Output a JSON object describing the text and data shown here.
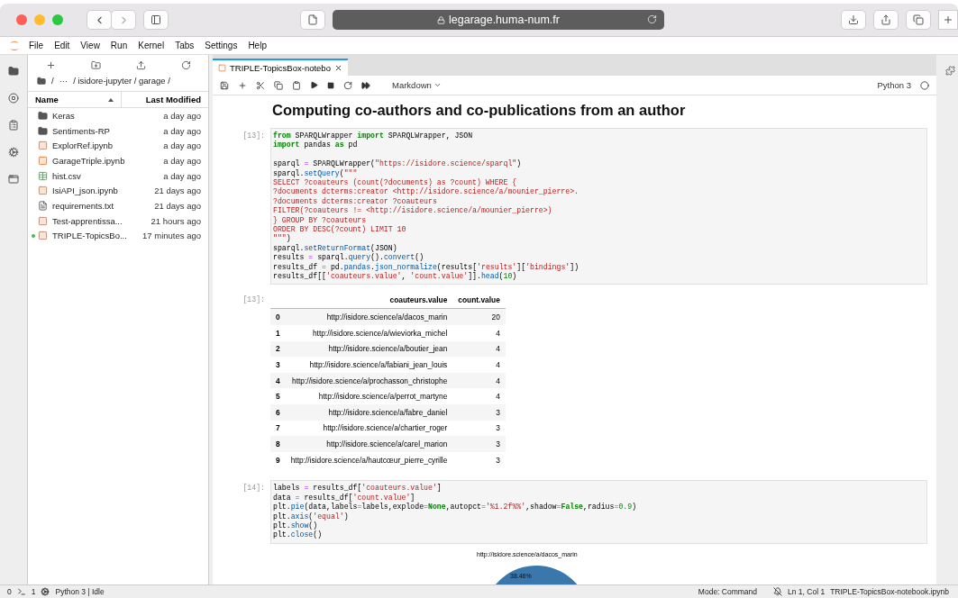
{
  "browser": {
    "url": "legarage.huma-num.fr"
  },
  "menu": [
    "File",
    "Edit",
    "View",
    "Run",
    "Kernel",
    "Tabs",
    "Settings",
    "Help"
  ],
  "file_browser": {
    "breadcrumb": [
      "/",
      "···",
      "/ isidore-jupyter / garage /"
    ],
    "columns": [
      {
        "label": "Name",
        "sorted": true
      },
      {
        "label": "Last Modified",
        "sorted": false
      }
    ],
    "files": [
      {
        "name": "Keras",
        "kind": "folder",
        "modified": "a day ago",
        "running": false
      },
      {
        "name": "Sentiments-RP",
        "kind": "folder",
        "modified": "a day ago",
        "running": false
      },
      {
        "name": "ExplorRef.ipynb",
        "kind": "notebook",
        "modified": "a day ago",
        "running": false
      },
      {
        "name": "GarageTriple.ipynb",
        "kind": "notebook",
        "modified": "a day ago",
        "running": false
      },
      {
        "name": "hist.csv",
        "kind": "csv",
        "modified": "a day ago",
        "running": false
      },
      {
        "name": "IsiAPI_json.ipynb",
        "kind": "notebook",
        "modified": "21 days ago",
        "running": false
      },
      {
        "name": "requirements.txt",
        "kind": "text",
        "modified": "21 days ago",
        "running": false
      },
      {
        "name": "Test-apprentissa...",
        "kind": "notebook",
        "modified": "21 hours ago",
        "running": false
      },
      {
        "name": "TRIPLE-TopicsBo...",
        "kind": "notebook",
        "modified": "17 minutes ago",
        "running": true
      }
    ]
  },
  "notebook": {
    "tab": {
      "title": "TRIPLE-TopicsBox-notebo",
      "selected": true
    },
    "cell_type": "Markdown",
    "kernel": "Python 3",
    "heading": "Computing co-authors and co-publications from an author",
    "cells": [
      {
        "prompt": "[13]:",
        "blocks": [
          [
            [
              {
                "kind": "keyword",
                "text": "from"
              },
              {
                "kind": "plain",
                "text": " SPARQLWrapper "
              },
              {
                "kind": "keyword",
                "text": "import"
              },
              {
                "kind": "plain",
                "text": " SPARQLWrapper, JSON"
              }
            ],
            [
              {
                "kind": "keyword",
                "text": "import"
              },
              {
                "kind": "plain",
                "text": " pandas "
              },
              {
                "kind": "keyword",
                "text": "as"
              },
              {
                "kind": "plain",
                "text": " pd"
              }
            ]
          ],
          [
            [
              {
                "kind": "plain",
                "text": "sparql "
              },
              {
                "kind": "operator",
                "text": "="
              },
              {
                "kind": "plain",
                "text": " SPARQLWrapper("
              },
              {
                "kind": "string",
                "text": "\"https://isidore.science/sparql\""
              },
              {
                "kind": "plain",
                "text": ")"
              }
            ],
            [
              {
                "kind": "plain",
                "text": "sparql."
              },
              {
                "kind": "function",
                "text": "setQuery"
              },
              {
                "kind": "plain",
                "text": "("
              },
              {
                "kind": "string",
                "text": "\"\"\""
              }
            ],
            [
              {
                "kind": "string",
                "text": "SELECT ?coauteurs (count(?documents) as ?count) WHERE {"
              }
            ],
            [
              {
                "kind": "string",
                "text": "?documents dcterms:creator <http://isidore.science/a/mounier_pierre>."
              }
            ],
            [
              {
                "kind": "string",
                "text": "?documents dcterms:creator ?coauteurs"
              }
            ],
            [
              {
                "kind": "string",
                "text": "FILTER(?coauteurs != <http://isidore.science/a/mounier_pierre>)"
              }
            ],
            [
              {
                "kind": "string",
                "text": "} GROUP BY ?coauteurs"
              }
            ],
            [
              {
                "kind": "string",
                "text": "ORDER BY DESC(?count) LIMIT 10"
              }
            ],
            [
              {
                "kind": "string",
                "text": "\"\"\""
              },
              {
                "kind": "plain",
                "text": ")"
              }
            ],
            [
              {
                "kind": "plain",
                "text": "sparql."
              },
              {
                "kind": "function",
                "text": "setReturnFormat"
              },
              {
                "kind": "plain",
                "text": "(JSON)"
              }
            ],
            [
              {
                "kind": "plain",
                "text": "results "
              },
              {
                "kind": "operator",
                "text": "="
              },
              {
                "kind": "plain",
                "text": " sparql."
              },
              {
                "kind": "function",
                "text": "query"
              },
              {
                "kind": "plain",
                "text": "()."
              },
              {
                "kind": "function",
                "text": "convert"
              },
              {
                "kind": "plain",
                "text": "()"
              }
            ],
            [
              {
                "kind": "plain",
                "text": "results_df "
              },
              {
                "kind": "operator",
                "text": "="
              },
              {
                "kind": "plain",
                "text": " pd."
              },
              {
                "kind": "function",
                "text": "pandas"
              },
              {
                "kind": "plain",
                "text": "."
              },
              {
                "kind": "function",
                "text": "json_normalize"
              },
              {
                "kind": "plain",
                "text": "(results["
              },
              {
                "kind": "string",
                "text": "'results'"
              },
              {
                "kind": "plain",
                "text": "]["
              },
              {
                "kind": "string",
                "text": "'bindings'"
              },
              {
                "kind": "plain",
                "text": "])"
              }
            ],
            [
              {
                "kind": "plain",
                "text": "results_df[["
              },
              {
                "kind": "string",
                "text": "'coauteurs.value'"
              },
              {
                "kind": "plain",
                "text": ", "
              },
              {
                "kind": "string",
                "text": "'count.value'"
              },
              {
                "kind": "plain",
                "text": "]]."
              },
              {
                "kind": "function",
                "text": "head"
              },
              {
                "kind": "plain",
                "text": "("
              },
              {
                "kind": "number",
                "text": "10"
              },
              {
                "kind": "plain",
                "text": ")"
              }
            ]
          ]
        ],
        "output": {
          "prompt": "[13]:",
          "columns": [
            "",
            "coauteurs.value",
            "count.value"
          ],
          "rows": [
            [
              "0",
              "http://isidore.science/a/dacos_marin",
              "20"
            ],
            [
              "1",
              "http://isidore.science/a/wieviorka_michel",
              "4"
            ],
            [
              "2",
              "http://isidore.science/a/boutier_jean",
              "4"
            ],
            [
              "3",
              "http://isidore.science/a/fabiani_jean_louis",
              "4"
            ],
            [
              "4",
              "http://isidore.science/a/prochasson_christophe",
              "4"
            ],
            [
              "5",
              "http://isidore.science/a/perrot_martyne",
              "4"
            ],
            [
              "6",
              "http://isidore.science/a/fabre_daniel",
              "3"
            ],
            [
              "7",
              "http://isidore.science/a/chartier_roger",
              "3"
            ],
            [
              "8",
              "http://isidore.science/a/carel_marion",
              "3"
            ],
            [
              "9",
              "http://isidore.science/a/hautcœur_pierre_cyrille",
              "3"
            ]
          ]
        }
      },
      {
        "prompt": "[14]:",
        "blocks": [
          [
            [
              {
                "kind": "plain",
                "text": "labels "
              },
              {
                "kind": "operator",
                "text": "="
              },
              {
                "kind": "plain",
                "text": " results_df["
              },
              {
                "kind": "string",
                "text": "'coauteurs.value'"
              },
              {
                "kind": "plain",
                "text": "]"
              }
            ],
            [
              {
                "kind": "plain",
                "text": "data "
              },
              {
                "kind": "operator",
                "text": "="
              },
              {
                "kind": "plain",
                "text": " results_df["
              },
              {
                "kind": "string",
                "text": "'count.value'"
              },
              {
                "kind": "plain",
                "text": "]"
              }
            ],
            [
              {
                "kind": "plain",
                "text": "plt."
              },
              {
                "kind": "function",
                "text": "pie"
              },
              {
                "kind": "plain",
                "text": "(data,labels"
              },
              {
                "kind": "operator",
                "text": "="
              },
              {
                "kind": "plain",
                "text": "labels,explode"
              },
              {
                "kind": "operator",
                "text": "="
              },
              {
                "kind": "keyword",
                "text": "None"
              },
              {
                "kind": "plain",
                "text": ",autopct"
              },
              {
                "kind": "operator",
                "text": "="
              },
              {
                "kind": "string",
                "text": "'%1.2f%%'"
              },
              {
                "kind": "plain",
                "text": ",shadow"
              },
              {
                "kind": "operator",
                "text": "="
              },
              {
                "kind": "keyword",
                "text": "False"
              },
              {
                "kind": "plain",
                "text": ",radius"
              },
              {
                "kind": "operator",
                "text": "="
              },
              {
                "kind": "number",
                "text": "0.9"
              },
              {
                "kind": "plain",
                "text": ")"
              }
            ],
            [
              {
                "kind": "plain",
                "text": "plt."
              },
              {
                "kind": "function",
                "text": "axis"
              },
              {
                "kind": "plain",
                "text": "("
              },
              {
                "kind": "string",
                "text": "'equal'"
              },
              {
                "kind": "plain",
                "text": ")"
              }
            ],
            [
              {
                "kind": "plain",
                "text": "plt."
              },
              {
                "kind": "function",
                "text": "show"
              },
              {
                "kind": "plain",
                "text": "()"
              }
            ],
            [
              {
                "kind": "plain",
                "text": "plt."
              },
              {
                "kind": "function",
                "text": "close"
              },
              {
                "kind": "plain",
                "text": "()"
              }
            ]
          ]
        ],
        "figure": {
          "label": "http://isidore.science/a/dacos_marin",
          "percent": "38.46%"
        }
      }
    ]
  },
  "status_bar": {
    "terminals": "0",
    "consoles": "1",
    "kernel": "Python 3 | Idle",
    "mode": "Mode: Command",
    "position": "Ln 1, Col 1",
    "file": "TRIPLE-TopicsBox-notebook.ipynb"
  }
}
